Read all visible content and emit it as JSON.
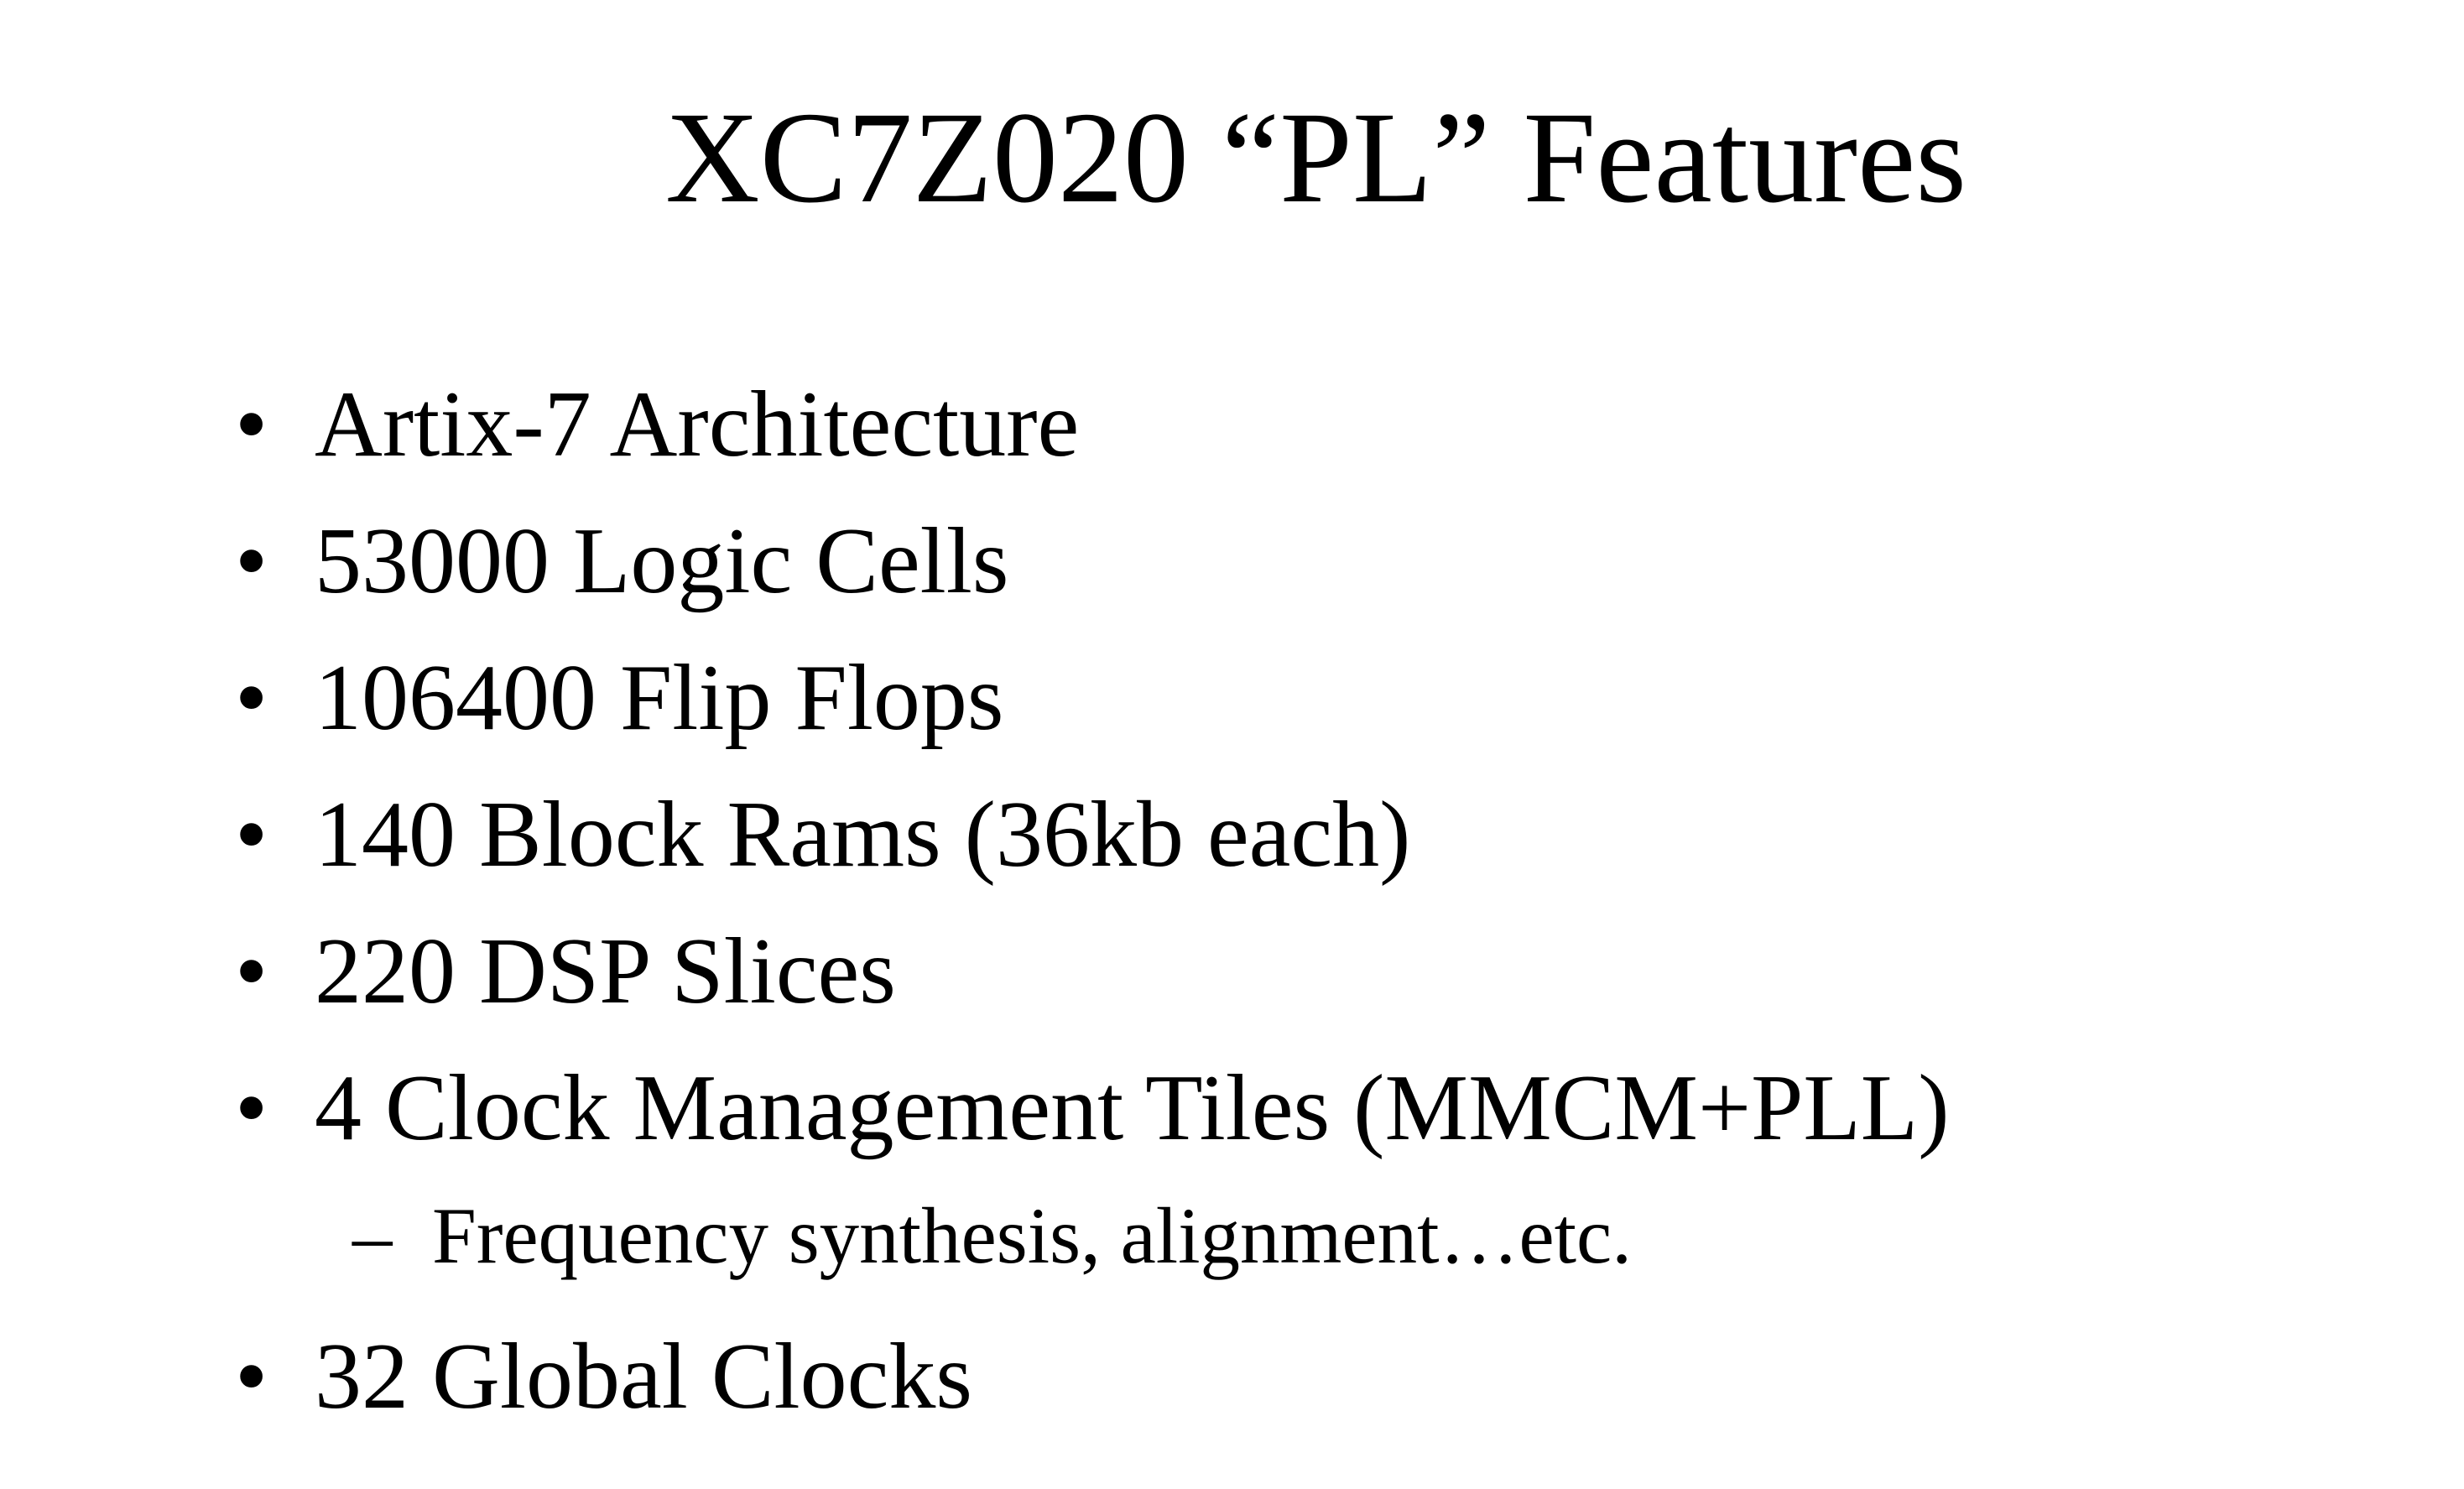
{
  "slide": {
    "title": "XC7Z020 “PL” Features",
    "bullets": [
      "Artix-7 Architecture",
      "53000 Logic Cells",
      "106400 Flip Flops",
      "140 Block Rams (36kb each)",
      "220 DSP Slices",
      "4 Clock Management Tiles (MMCM+PLL)"
    ],
    "sub_bullet": "Frequency synthesis, alignment…etc.",
    "last_bullet": "32 Global Clocks",
    "bullet_symbol": "•",
    "sub_symbol": "–"
  }
}
